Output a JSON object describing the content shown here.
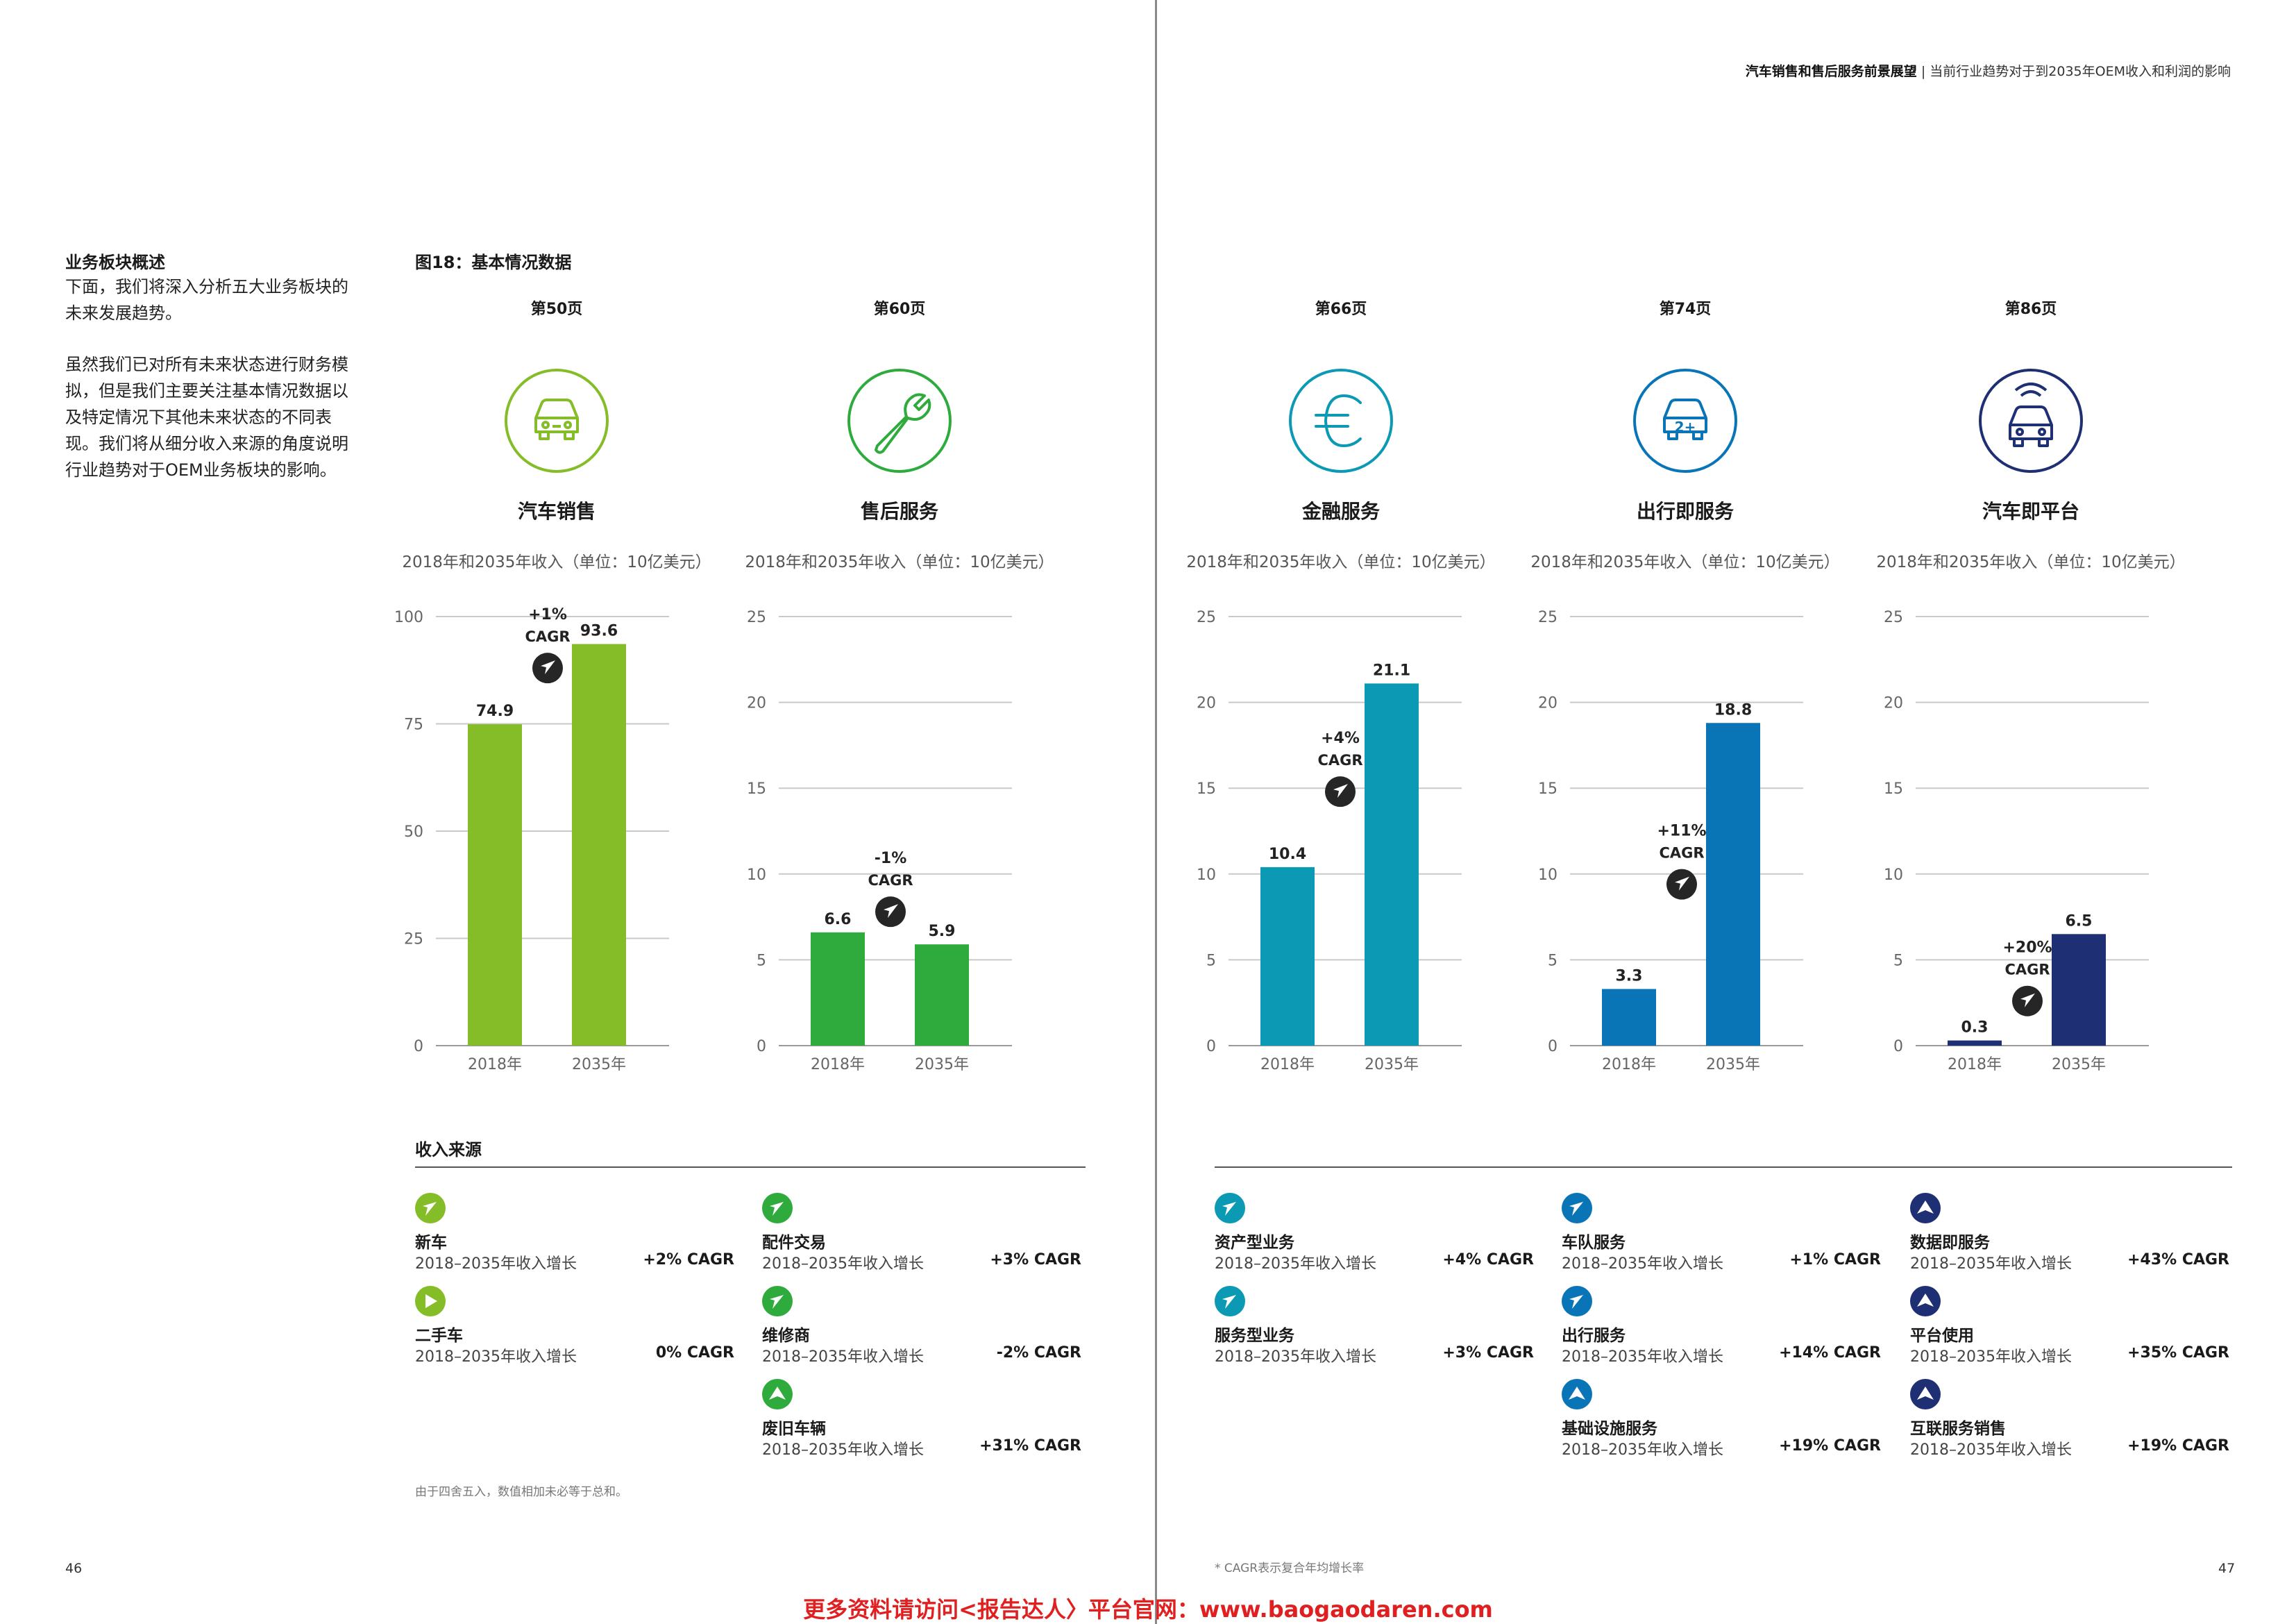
{
  "header": {
    "bold": "汽车销售和售后服务前景展望",
    "sep": " | ",
    "rest": "当前行业趋势对于到2035年OEM收入和利润的影响"
  },
  "intro": {
    "title": "业务板块概述",
    "line1": "下面，我们将深入分析五大业务板块的",
    "line2": "未来发展趋势。",
    "p2_lines": [
      "虽然我们已对所有未来状态进行财务模",
      "拟，但是我们主要关注基本情况数据以",
      "及特定情况下其他未来状态的不同表",
      "现。我们将从细分收入来源的角度说明",
      "行业趋势对于OEM业务板块的影响。"
    ]
  },
  "figure_title": "图18：基本情况数据",
  "unit_note": "2018年和2035年收入（单位：10亿美元）",
  "segments": [
    {
      "page": "第50页",
      "name": "汽车销售",
      "icon": "car-icon",
      "color": "#84bd27"
    },
    {
      "page": "第60页",
      "name": "售后服务",
      "icon": "wrench-icon",
      "color": "#2eab3c"
    },
    {
      "page": "第66页",
      "name": "金融服务",
      "icon": "euro-icon",
      "color": "#0b99b4"
    },
    {
      "page": "第74页",
      "name": "出行即服务",
      "icon": "shared-car-icon",
      "color": "#0a75b6"
    },
    {
      "page": "第86页",
      "name": "汽车即平台",
      "icon": "connected-car-icon",
      "color": "#1e2f73"
    }
  ],
  "chart_data": [
    {
      "type": "bar",
      "title": "汽车销售",
      "categories": [
        "2018年",
        "2035年"
      ],
      "values": [
        74.9,
        93.6
      ],
      "ylim": [
        0,
        100
      ],
      "yticks": [
        0,
        25,
        50,
        75,
        100
      ],
      "cagr": "+1%",
      "cagr_label": "CAGR",
      "color": "#84bd27"
    },
    {
      "type": "bar",
      "title": "售后服务",
      "categories": [
        "2018年",
        "2035年"
      ],
      "values": [
        6.6,
        5.9
      ],
      "ylim": [
        0,
        25
      ],
      "yticks": [
        0,
        5,
        10,
        15,
        20,
        25
      ],
      "cagr": "-1%",
      "cagr_label": "CAGR",
      "color": "#2eab3c"
    },
    {
      "type": "bar",
      "title": "金融服务",
      "categories": [
        "2018年",
        "2035年"
      ],
      "values": [
        10.4,
        21.1
      ],
      "ylim": [
        0,
        25
      ],
      "yticks": [
        0,
        5,
        10,
        15,
        20,
        25
      ],
      "cagr": "+4%",
      "cagr_label": "CAGR",
      "color": "#0b99b4"
    },
    {
      "type": "bar",
      "title": "出行即服务",
      "categories": [
        "2018年",
        "2035年"
      ],
      "values": [
        3.3,
        18.8
      ],
      "ylim": [
        0,
        25
      ],
      "yticks": [
        0,
        5,
        10,
        15,
        20,
        25
      ],
      "cagr": "+11%",
      "cagr_label": "CAGR",
      "color": "#0a75b6"
    },
    {
      "type": "bar",
      "title": "汽车即平台",
      "categories": [
        "2018年",
        "2035年"
      ],
      "values": [
        0.3,
        6.5
      ],
      "ylim": [
        0,
        25
      ],
      "yticks": [
        0,
        5,
        10,
        15,
        20,
        25
      ],
      "cagr": "+20%",
      "cagr_label": "CAGR",
      "color": "#1e2f73"
    }
  ],
  "revenue_section_title": "收入来源",
  "revenue_sub": "2018–2035年收入增长",
  "revenue_columns": [
    {
      "color": "#84bd27",
      "items": [
        {
          "name": "新车",
          "cagr": "+2% CAGR",
          "dir": "up-right"
        },
        {
          "name": "二手车",
          "cagr": "0% CAGR",
          "dir": "right"
        }
      ]
    },
    {
      "color": "#2eab3c",
      "items": [
        {
          "name": "配件交易",
          "cagr": "+3% CAGR",
          "dir": "up-right"
        },
        {
          "name": "维修商",
          "cagr": "-2% CAGR",
          "dir": "up-right"
        },
        {
          "name": "废旧车辆",
          "cagr": "+31% CAGR",
          "dir": "up"
        }
      ]
    },
    {
      "color": "#0b99b4",
      "items": [
        {
          "name": "资产型业务",
          "cagr": "+4% CAGR",
          "dir": "up-right"
        },
        {
          "name": "服务型业务",
          "cagr": "+3% CAGR",
          "dir": "up-right"
        }
      ]
    },
    {
      "color": "#0a75b6",
      "items": [
        {
          "name": "车队服务",
          "cagr": "+1% CAGR",
          "dir": "up-right"
        },
        {
          "name": "出行服务",
          "cagr": "+14% CAGR",
          "dir": "up-right"
        },
        {
          "name": "基础设施服务",
          "cagr": "+19% CAGR",
          "dir": "up"
        }
      ]
    },
    {
      "color": "#1e2f73",
      "items": [
        {
          "name": "数据即服务",
          "cagr": "+43% CAGR",
          "dir": "up"
        },
        {
          "name": "平台使用",
          "cagr": "+35% CAGR",
          "dir": "up"
        },
        {
          "name": "互联服务销售",
          "cagr": "+19% CAGR",
          "dir": "up"
        }
      ]
    }
  ],
  "footnote_left": "由于四舍五入，数值相加未必等于总和。",
  "footnote_right": "* CAGR表示复合年均增长率",
  "page_left": "46",
  "page_right": "47",
  "promo": "更多资料请访问<报告达人〉平台官网：www.baogaodaren.com"
}
